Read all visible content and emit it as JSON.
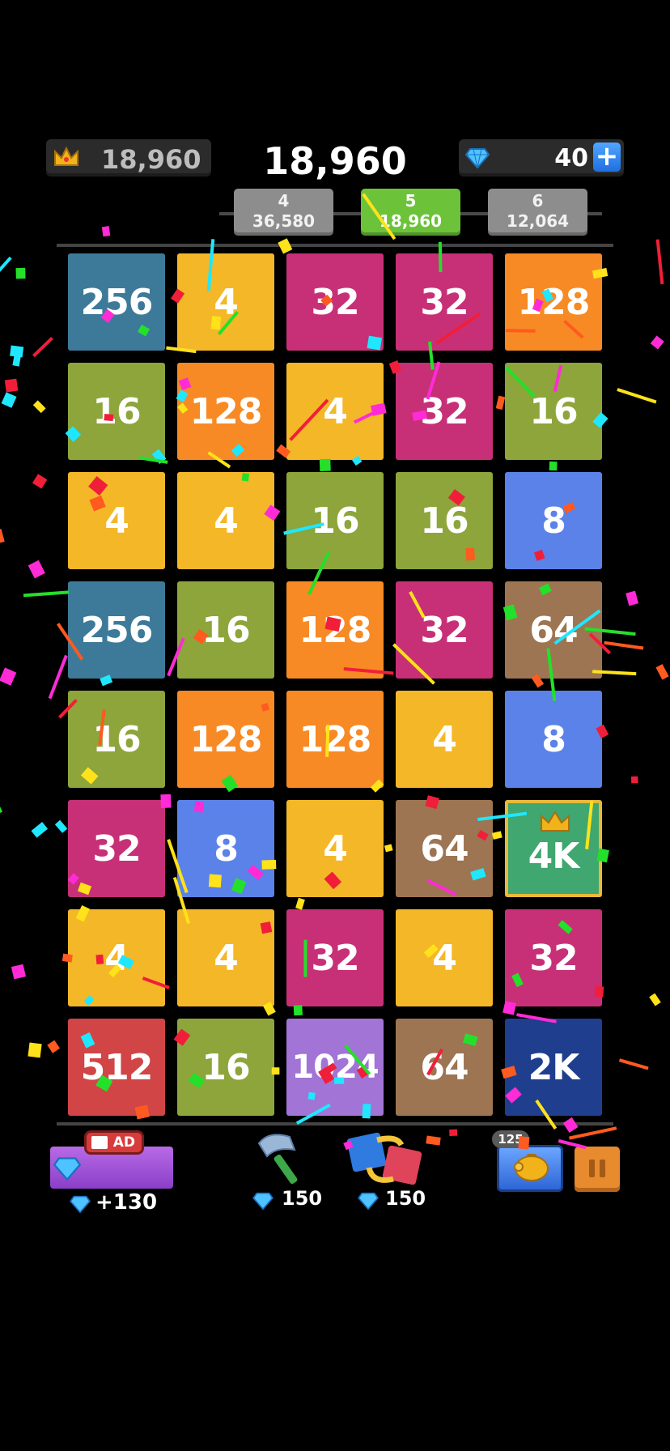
{
  "header": {
    "best_score": "18,960",
    "score": "18,960",
    "gems": "40",
    "plus_label": "+"
  },
  "levels": [
    {
      "level": "4",
      "score": "36,580",
      "state": "past"
    },
    {
      "level": "5",
      "score": "18,960",
      "state": "current"
    },
    {
      "level": "6",
      "score": "12,064",
      "state": "next"
    }
  ],
  "board": {
    "rows": [
      [
        "256",
        "4",
        "32",
        "32",
        "128"
      ],
      [
        "16",
        "128",
        "4",
        "32",
        "16"
      ],
      [
        "4",
        "4",
        "16",
        "16",
        "8"
      ],
      [
        "256",
        "16",
        "128",
        "32",
        "64"
      ],
      [
        "16",
        "128",
        "128",
        "4",
        "8"
      ],
      [
        "32",
        "8",
        "4",
        "64",
        "4K"
      ],
      [
        "4",
        "4",
        "32",
        "4",
        "32"
      ],
      [
        "512",
        "16",
        "1024",
        "64",
        "2K"
      ]
    ]
  },
  "bottom_bar": {
    "ad_label": "AD",
    "ad_reward": "+130",
    "hammer_cost": "150",
    "swap_cost": "150",
    "piggy_count": "125"
  },
  "colors": {
    "background": "#000000",
    "current_level": "#6cc33a",
    "other_level": "#8d8d8d"
  }
}
